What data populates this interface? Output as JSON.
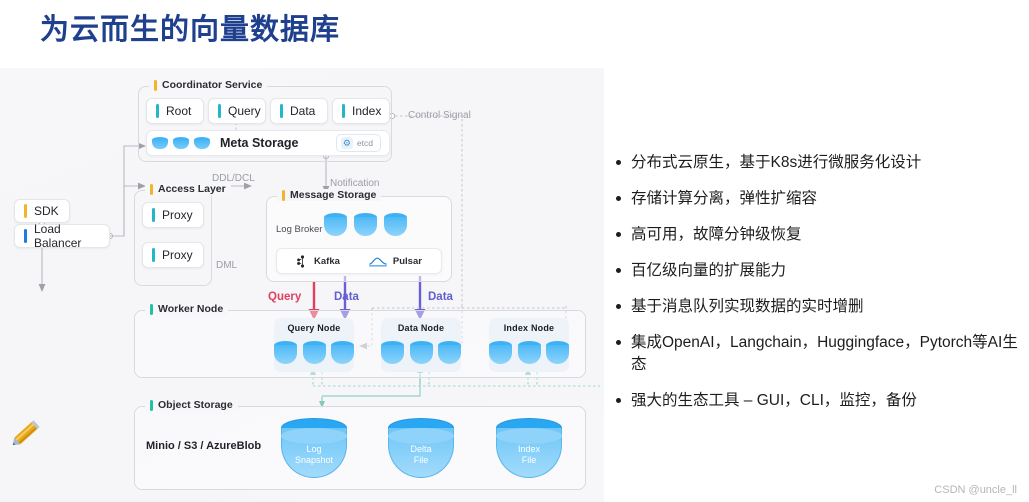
{
  "slide": {
    "title": "为云而生的向量数据库",
    "watermark": "CSDN @uncle_ll",
    "title_color": "#1f3f8f"
  },
  "diagram": {
    "sdk": "SDK",
    "load_balancer": "Load Balancer",
    "coordinator": {
      "label": "Coordinator Service",
      "services": [
        "Root",
        "Query",
        "Data",
        "Index"
      ],
      "meta_storage": "Meta Storage",
      "etcd": "etcd"
    },
    "access_layer": {
      "label": "Access Layer",
      "proxies": [
        "Proxy",
        "Proxy"
      ]
    },
    "message_storage": {
      "label": "Message Storage",
      "log_broker": "Log Broker",
      "brokers": [
        "Kafka",
        "Pulsar"
      ]
    },
    "worker_node": {
      "label": "Worker Node",
      "nodes": [
        "Query Node",
        "Data Node",
        "Index Node"
      ]
    },
    "object_storage": {
      "label": "Object Storage",
      "providers": "Minio / S3 / AzureBlob",
      "files": [
        {
          "l1": "Log",
          "l2": "Snapshot"
        },
        {
          "l1": "Delta",
          "l2": "File"
        },
        {
          "l1": "Index",
          "l2": "File"
        }
      ]
    },
    "connectors": {
      "control_signal": "Control Signal",
      "ddl_dcl": "DDL/DCL",
      "notification": "Notification",
      "dml": "DML",
      "query": "Query",
      "data_1": "Data",
      "data_2": "Data"
    }
  },
  "bullets": [
    "分布式云原生，基于K8s进行微服务化设计",
    "存储计算分离，弹性扩缩容",
    "高可用，故障分钟级恢复",
    "百亿级向量的扩展能力",
    "基于消息队列实现数据的实时增删",
    "集成OpenAI，Langchain，Huggingface，Pytorch等AI生态",
    "强大的生态工具 – GUI，CLI，监控，备份"
  ]
}
